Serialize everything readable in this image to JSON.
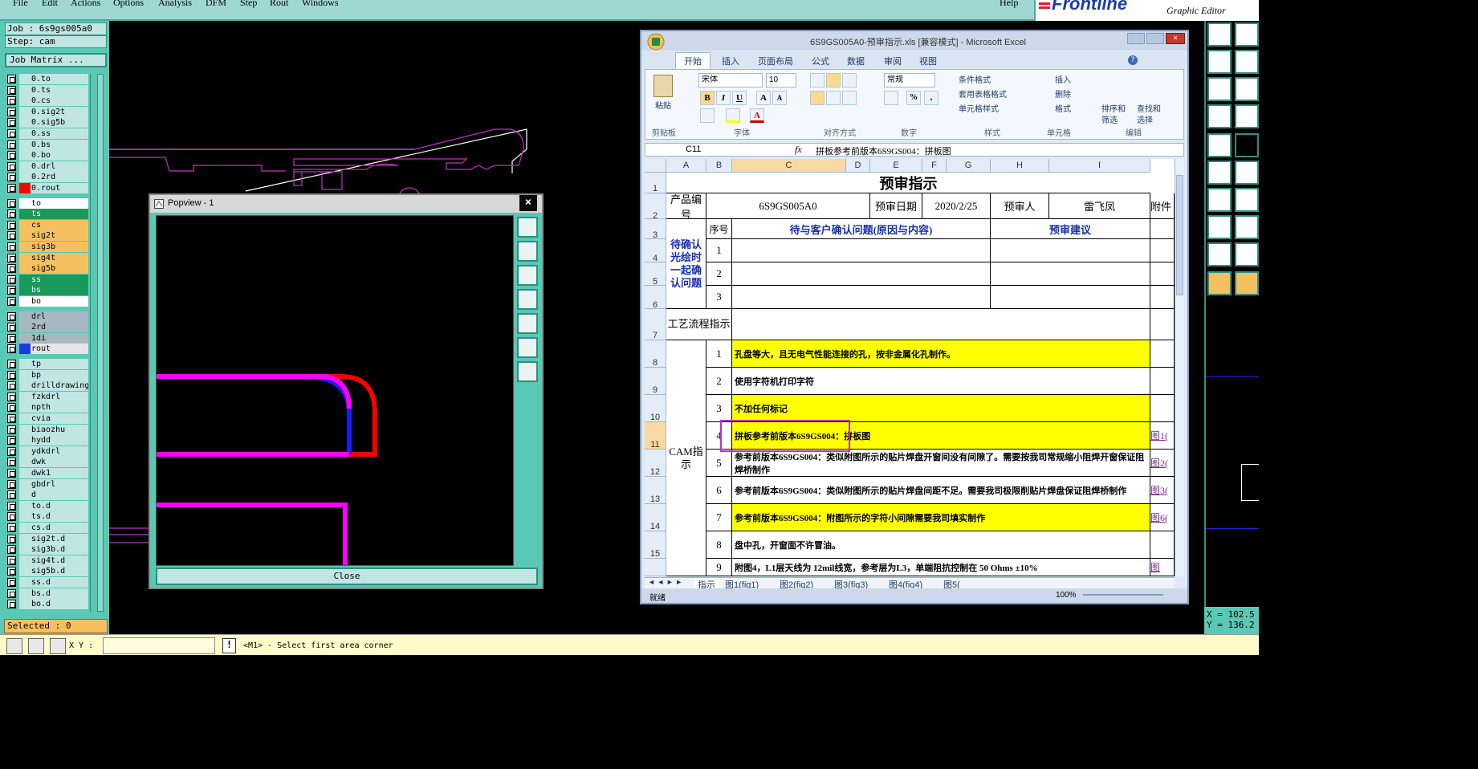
{
  "menubar": {
    "items": [
      "File",
      "Edit",
      "Actions",
      "Options",
      "Analysis",
      "DFM",
      "Step",
      "Rout",
      "Windows"
    ],
    "help": "Help"
  },
  "logo": {
    "brand": "Frontline",
    "subtitle": "Graphic Editor"
  },
  "job": {
    "job_label": "Job : 6s9gs005a0",
    "step_label": "Step: cam",
    "matrix_button": "Job Matrix ..."
  },
  "layers": [
    {
      "name": "0.to",
      "color": "#bfe6e2"
    },
    {
      "name": "0.ts",
      "color": "#bfe6e2"
    },
    {
      "name": "0.cs",
      "color": "#bfe6e2"
    },
    {
      "name": "0.sig2t",
      "color": "#bfe6e2"
    },
    {
      "name": "0.sig5b",
      "color": "#bfe6e2"
    },
    {
      "name": "0.ss",
      "color": "#bfe6e2"
    },
    {
      "name": "0.bs",
      "color": "#bfe6e2"
    },
    {
      "name": "0.bo",
      "color": "#bfe6e2"
    },
    {
      "name": "0.drl",
      "color": "#bfe6e2"
    },
    {
      "name": "0.2rd",
      "color": "#bfe6e2"
    },
    {
      "name": "0.rout",
      "color": "#ff0000"
    },
    {
      "name": "to",
      "color": "#ffffff"
    },
    {
      "name": "ts",
      "color": "#1a9a5a"
    },
    {
      "name": "cs",
      "color": "#f5c060"
    },
    {
      "name": "sig2t",
      "color": "#f5c060"
    },
    {
      "name": "sig3b",
      "color": "#f5c060"
    },
    {
      "name": "sig4t",
      "color": "#f5c060"
    },
    {
      "name": "sig5b",
      "color": "#f5c060"
    },
    {
      "name": "ss",
      "color": "#1a9a5a"
    },
    {
      "name": "bs",
      "color": "#1a9a5a"
    },
    {
      "name": "bo",
      "color": "#ffffff"
    },
    {
      "name": "drl",
      "color": "#a8b8c0"
    },
    {
      "name": "2rd",
      "color": "#a8b8c0"
    },
    {
      "name": "1di",
      "color": "#a8b8c0"
    },
    {
      "name": "rout",
      "color": "#1a3ae8"
    },
    {
      "name": "tp",
      "color": "#bfe6e2"
    },
    {
      "name": "bp",
      "color": "#bfe6e2"
    },
    {
      "name": "drilldrawing",
      "color": "#bfe6e2"
    },
    {
      "name": "fzkdrl",
      "color": "#bfe6e2"
    },
    {
      "name": "npth",
      "color": "#bfe6e2"
    },
    {
      "name": "cvia",
      "color": "#bfe6e2"
    },
    {
      "name": "biaozhu",
      "color": "#bfe6e2"
    },
    {
      "name": "hydd",
      "color": "#bfe6e2"
    },
    {
      "name": "ydkdrl",
      "color": "#bfe6e2"
    },
    {
      "name": "dwk",
      "color": "#bfe6e2"
    },
    {
      "name": "dwk1",
      "color": "#bfe6e2"
    },
    {
      "name": "gbdrl",
      "color": "#bfe6e2"
    },
    {
      "name": "d",
      "color": "#bfe6e2"
    },
    {
      "name": "to.d",
      "color": "#bfe6e2"
    },
    {
      "name": "ts.d",
      "color": "#bfe6e2"
    },
    {
      "name": "cs.d",
      "color": "#bfe6e2"
    },
    {
      "name": "sig2t.d",
      "color": "#bfe6e2"
    },
    {
      "name": "sig3b.d",
      "color": "#bfe6e2"
    },
    {
      "name": "sig4t.d",
      "color": "#bfe6e2"
    },
    {
      "name": "sig5b.d",
      "color": "#bfe6e2"
    },
    {
      "name": "ss.d",
      "color": "#bfe6e2"
    },
    {
      "name": "bs.d",
      "color": "#bfe6e2"
    },
    {
      "name": "bo.d",
      "color": "#bfe6e2"
    }
  ],
  "selected": "Selected : 0",
  "bottombar": {
    "xy_label": "X Y :",
    "warn": "!",
    "prompt": "<M1> - Select first area corner"
  },
  "coords": {
    "x": "X = 102.5",
    "y": "Y = 136.2"
  },
  "popview": {
    "title": "Popview - 1",
    "close_label": "Close"
  },
  "excel": {
    "title": "6S9GS005A0-预审指示.xls  [兼容模式] - Microsoft Excel",
    "tabs": [
      "开始",
      "插入",
      "页面布局",
      "公式",
      "数据",
      "审阅",
      "视图"
    ],
    "ribbon": {
      "paste": "粘贴",
      "font_name": "宋体",
      "font_size": "10",
      "number_format": "常规",
      "groups": [
        "剪贴板",
        "字体",
        "对齐方式",
        "数字",
        "样式",
        "单元格",
        "编辑"
      ],
      "cond_format": "条件格式",
      "table_format": "套用表格格式",
      "cell_style": "单元格样式",
      "insert": "插入",
      "delete": "删除",
      "format": "格式",
      "sort": "排序和",
      "filter": "筛选",
      "find": "查找和",
      "select": "选择"
    },
    "name_box": "C11",
    "formula": "拼板参考前版本6S9GS004：拼板图",
    "columns": [
      "A",
      "B",
      "C",
      "D",
      "E",
      "F",
      "G",
      "H",
      "I"
    ],
    "rows": [
      "1",
      "2",
      "3",
      "4",
      "5",
      "6",
      "7",
      "8",
      "9",
      "10",
      "11",
      "12",
      "13",
      "14",
      "15"
    ],
    "sheet_title": "预审指示",
    "product_label": "产品编号",
    "product_no": "6S9GS005A0",
    "date_label": "预审日期",
    "date": "2020/2/25",
    "person_label": "预审人",
    "person": "雷飞凤",
    "attach_label": "附件",
    "seq_label": "序号",
    "confirm_header": "待与客户确认问题(原因与内容)",
    "advice_header": "预审建议",
    "confirm_side": "待确认光绘时一起确认问题",
    "process_label": "工艺流程指示",
    "cam_label": "CAM指示",
    "items": [
      {
        "no": "1",
        "text": "孔盘等大，且无电气性能连接的孔，按非金属化孔制作。",
        "yellow": true,
        "link": ""
      },
      {
        "no": "2",
        "text": "使用字符机打印字符",
        "yellow": false,
        "link": ""
      },
      {
        "no": "3",
        "text": "不加任何标记",
        "yellow": true,
        "link": ""
      },
      {
        "no": "4",
        "text": "拼板参考前版本6S9GS004：拼板图",
        "yellow": true,
        "link": "图1("
      },
      {
        "no": "5",
        "text": "参考前版本6S9GS004：类似附图所示的贴片焊盘开窗间没有间隙了。需要按我司常规缩小阻焊开窗保证阻焊桥制作",
        "yellow": false,
        "link": "图2("
      },
      {
        "no": "6",
        "text": "参考前版本6S9GS004：类似附图所示的贴片焊盘间距不足。需要我司极限削贴片焊盘保证阻焊桥制作",
        "yellow": false,
        "link": "图3("
      },
      {
        "no": "7",
        "text": "参考前版本6S9GS004：附图所示的字符小间隙需要我司填实制作",
        "yellow": true,
        "link": "图6("
      },
      {
        "no": "8",
        "text": "盘中孔，开窗面不许冒油。",
        "yellow": false,
        "link": ""
      },
      {
        "no": "9",
        "text": "附图4，L1层天线为 12mil线宽，参考层为L3，单端阻抗控制在 50 Ohms ±10%",
        "yellow": false,
        "link": "图"
      }
    ],
    "confirm_nos": [
      "1",
      "2",
      "3"
    ],
    "sheets": [
      "指示",
      "图1(fig1)",
      "图2(fig2)",
      "图3(fig3)",
      "图4(fig4)",
      "图5("
    ],
    "status": "就绪",
    "zoom": "100%"
  }
}
